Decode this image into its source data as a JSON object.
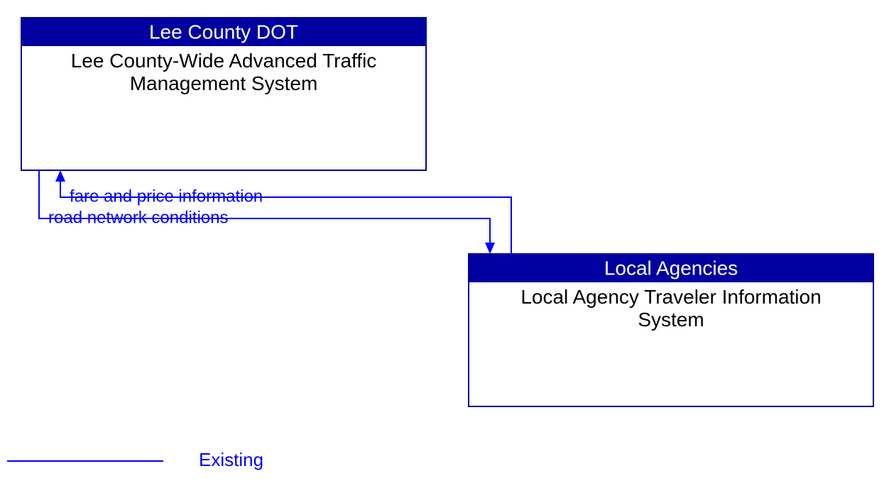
{
  "nodes": {
    "lee_county": {
      "header": "Lee County DOT",
      "title_line1": "Lee County-Wide Advanced Traffic",
      "title_line2": "Management System"
    },
    "local_agencies": {
      "header": "Local Agencies",
      "title_line1": "Local Agency Traveler Information",
      "title_line2": "System"
    }
  },
  "flows": {
    "fare_price": "fare and price information",
    "road_network": "road network conditions"
  },
  "legend": {
    "existing": "Existing"
  },
  "colors": {
    "header_bg": "#0000a0",
    "line": "#0000ff"
  }
}
